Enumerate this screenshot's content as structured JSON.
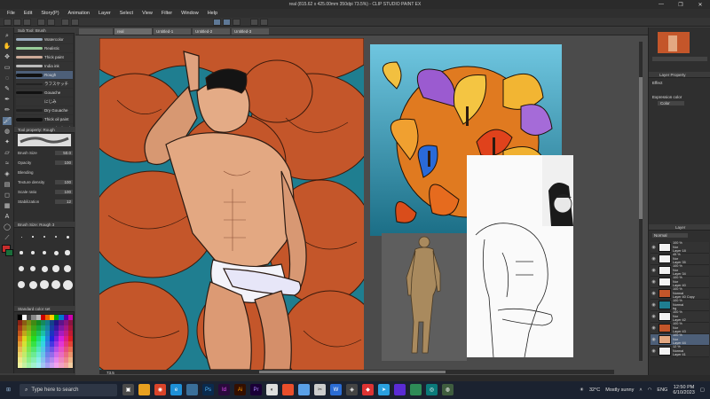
{
  "window": {
    "title": "real (815.62 x 425.00mm 350dpi 73.5%) - CLIP STUDIO PAINT EX",
    "controls": [
      "—",
      "❐",
      "✕"
    ]
  },
  "menu": [
    "File",
    "Edit",
    "Story(P)",
    "Animation",
    "Layer",
    "Select",
    "View",
    "Filter",
    "Window",
    "Help"
  ],
  "subtool_panel": {
    "tab1": "Sub Tool: Brush",
    "brushes": [
      "Watercolor",
      "Realistic",
      "Thick paint",
      "India ink",
      "Rough",
      "ラフスケッチ",
      "Gouache",
      "にじみ",
      "Dry Gouache",
      "Thick oil paint",
      "Gouache brush"
    ],
    "tab2": "Tool property: Rough",
    "props": [
      {
        "label": "Brush Size",
        "value": "50.0"
      },
      {
        "label": "Opacity",
        "value": "100"
      },
      {
        "label": "Blending",
        "value": ""
      },
      {
        "label": "Texture density",
        "value": "100"
      },
      {
        "label": "Scale ratio",
        "value": "100"
      },
      {
        "label": "Stabilization",
        "value": "12"
      }
    ],
    "tab3": "Brush Size: Rough 3",
    "tab4": "Standard color set"
  },
  "canvas": {
    "tabs": [
      "real",
      "Untitled-1",
      "Untitled-2",
      "Untitled-3"
    ],
    "zoom": "73.5"
  },
  "right_panel": {
    "layer_property_tab": "Layer Property",
    "effect_label": "Effect",
    "expression_label": "Expression color",
    "expression_value": "Color",
    "layers_tab": "Layer",
    "blend": "Normal",
    "layers": [
      {
        "opacity": "100 %",
        "mode": "Nor",
        "name": "Layer 18"
      },
      {
        "opacity": "45 %",
        "mode": "Nor",
        "name": "Layer 35"
      },
      {
        "opacity": "100 %",
        "mode": "Nor",
        "name": "Layer 34"
      },
      {
        "opacity": "100 %",
        "mode": "Nor",
        "name": "Layer 40"
      },
      {
        "opacity": "100 %",
        "mode": "Normal",
        "name": "Layer 40 Copy"
      },
      {
        "opacity": "100 %",
        "mode": "Normal",
        "name": "bg"
      },
      {
        "opacity": "100 %",
        "mode": "Nor",
        "name": "Layer 42"
      },
      {
        "opacity": "100 %",
        "mode": "Nor",
        "name": "Layer 43"
      },
      {
        "opacity": "100 %",
        "mode": "Nor",
        "name": "Layer 44"
      },
      {
        "opacity": "12 %",
        "mode": "Normal",
        "name": "Layer 41"
      }
    ]
  },
  "taskbar": {
    "search_placeholder": "Type here to search",
    "weather_temp": "32°C",
    "weather_text": "Mostly sunny",
    "lang": "ENG",
    "time": "12:50 PM",
    "date": "6/10/2023"
  },
  "colors": {
    "canvas_teal": "#1f7e90",
    "flower_orange": "#c4562a",
    "selection": "#4d5f78"
  }
}
